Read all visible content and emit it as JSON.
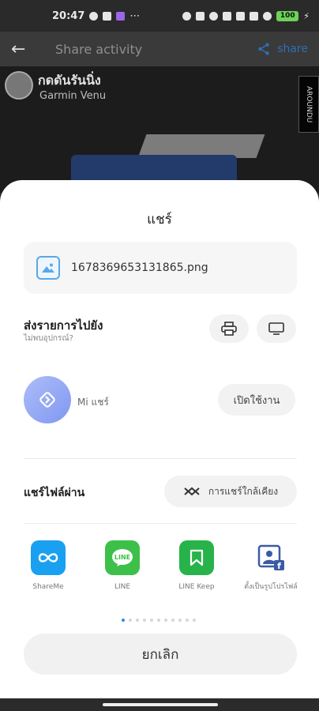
{
  "status_bar": {
    "time": "20:47",
    "more": "⋯",
    "battery": "100"
  },
  "app_bar": {
    "title": "Share activity",
    "share_label": "share"
  },
  "feed": {
    "user_name": "กดดันรันนิ่ง",
    "device": "Garmin Venu",
    "around_tag": "AROUNDU"
  },
  "sheet": {
    "title": "แชร์",
    "file_name": "1678369653131865.png",
    "send_to_title": "ส่งรายการไปยัง",
    "send_to_subtitle": "ไม่พบอุปกรณ์?",
    "mi_share_label": "Mi แชร์",
    "enable_button": "เปิดใช้งาน",
    "share_via_title": "แชร์ไฟล์ผ่าน",
    "nearby_share_button": "การแชร์ใกล้เคียง",
    "apps": [
      {
        "label": "ShareMe",
        "color": "#1aa0f0",
        "icon": "shareme-icon"
      },
      {
        "label": "LINE",
        "color": "#3cc04a",
        "icon": "line-icon"
      },
      {
        "label": "LINE Keep",
        "color": "#27b34a",
        "icon": "line-keep-icon"
      },
      {
        "label": "ตั้งเป็นรูปโปรไฟล์",
        "color": "#3b5ba5",
        "icon": "facebook-profile-icon"
      }
    ],
    "page_indicator": {
      "total": 11,
      "active": 0
    },
    "cancel_button": "ยกเลิก"
  }
}
